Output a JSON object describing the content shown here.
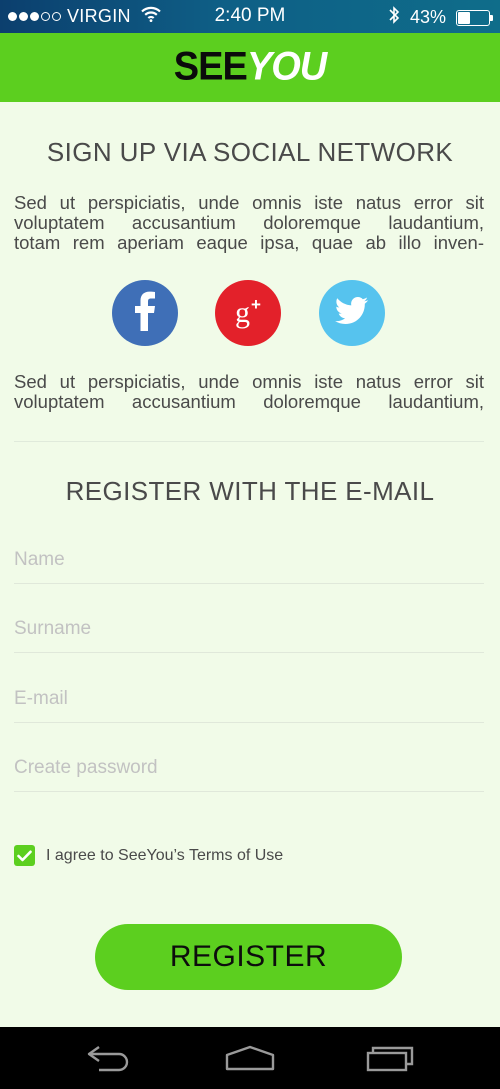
{
  "status_bar": {
    "carrier": "VIRGIN",
    "signal_bars_filled": 3,
    "signal_bars_total": 5,
    "time": "2:40 PM",
    "battery_percent": "43%",
    "battery_level": 0.43,
    "icons": [
      "wifi-icon",
      "bluetooth-icon",
      "battery-icon"
    ]
  },
  "header": {
    "logo_part1": "SEE",
    "logo_part2": "YOU",
    "bar_color": "#5ccf1f"
  },
  "social": {
    "title": "SIGN UP VIA SOCIAL NETWORK",
    "para1_lines": [
      "Sed ut perspiciatis, unde omnis iste natus error sit",
      "voluptatem accusantium doloremque laudantium,",
      "totam rem aperiam eaque ipsa, quae ab illo inven-"
    ],
    "para2_lines": [
      "Sed ut perspiciatis, unde omnis iste natus error sit",
      "voluptatem accusantium doloremque laudantium,"
    ],
    "buttons": [
      {
        "name": "facebook-icon",
        "glyph": "f",
        "color": "#3f6fb7"
      },
      {
        "name": "google-plus-icon",
        "glyph": "g+",
        "color": "#e3212a"
      },
      {
        "name": "twitter-icon",
        "glyph": "bird",
        "color": "#56c3ee"
      }
    ]
  },
  "email": {
    "title": "REGISTER WITH THE E-MAIL",
    "name_placeholder": "Name",
    "surname_placeholder": "Surname",
    "email_placeholder": "E-mail",
    "password_placeholder": "Create password",
    "agree_text": "I agree to SeeYou’s Terms of Use",
    "agree_checked": true,
    "register_label": "REGISTER"
  },
  "nav": {
    "icons": [
      "back-icon",
      "home-icon",
      "recent-apps-icon"
    ]
  },
  "colors": {
    "accent": "#5ccf1f",
    "background": "#f1fbe8",
    "text": "#4a4a4a"
  }
}
